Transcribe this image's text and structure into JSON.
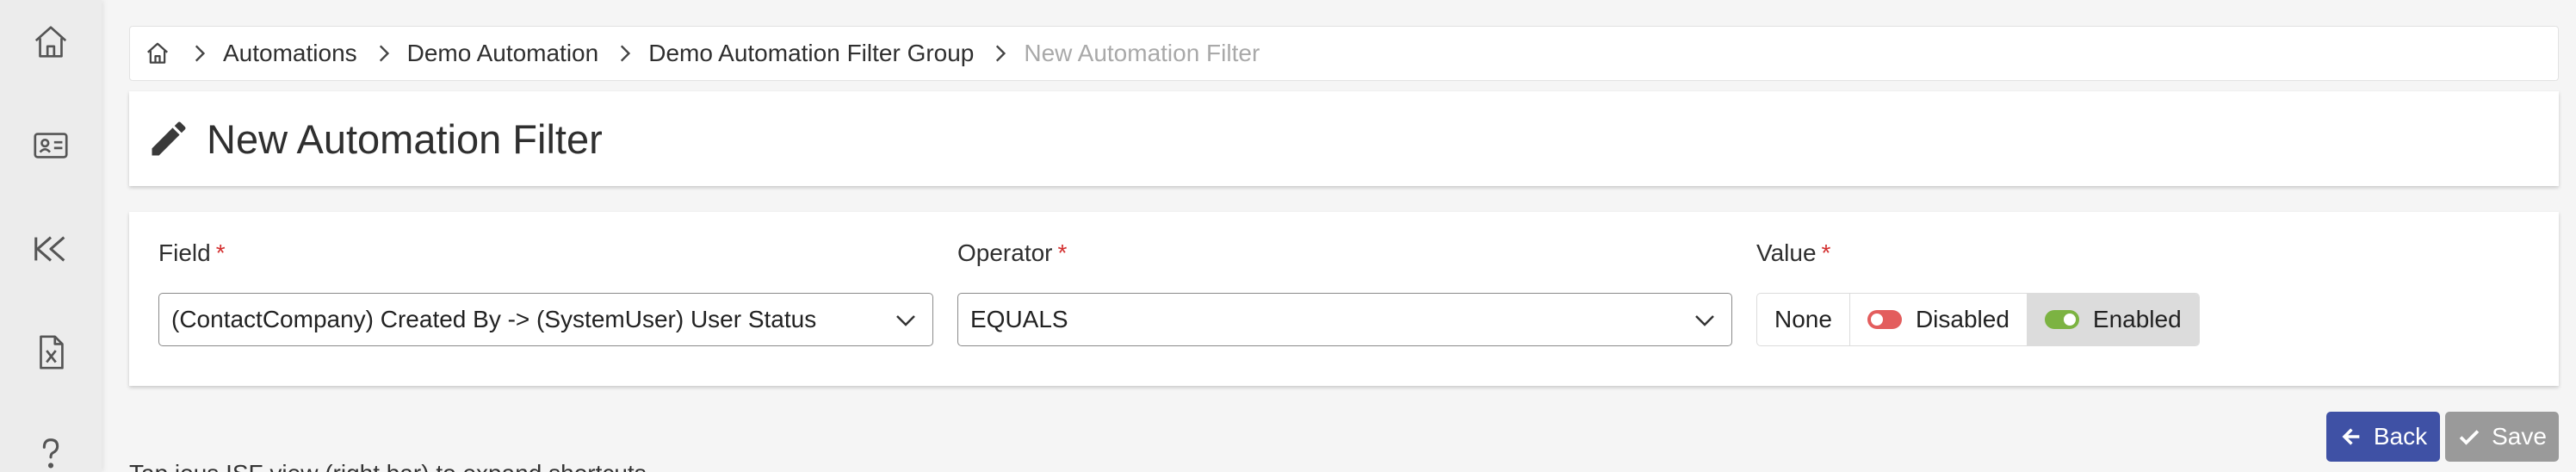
{
  "sidebar": {
    "items": [
      {
        "name": "home-icon"
      },
      {
        "name": "contact-card-icon"
      },
      {
        "name": "rewind-icon"
      },
      {
        "name": "excel-file-icon"
      },
      {
        "name": "help-icon"
      }
    ]
  },
  "breadcrumb": {
    "home_icon": "home-icon",
    "items": [
      "Automations",
      "Demo Automation",
      "Demo Automation Filter Group"
    ],
    "current": "New Automation Filter"
  },
  "page": {
    "title": "New Automation Filter",
    "title_icon": "pencil-icon"
  },
  "form": {
    "required_mark": "*",
    "field": {
      "label": "Field",
      "value": "(ContactCompany) Created By -> (SystemUser) User Status"
    },
    "operator": {
      "label": "Operator",
      "value": "EQUALS"
    },
    "value": {
      "label": "Value",
      "options": [
        "None",
        "Disabled",
        "Enabled"
      ],
      "selected": "Enabled"
    }
  },
  "actions": {
    "back_label": "Back",
    "save_label": "Save"
  },
  "hint": {
    "text": "Tap ious ISF view (right bar) to expand shortcuts"
  },
  "colors": {
    "accent": "#3f51a5",
    "required": "#d32f2f",
    "disabled_switch": "#e35d5d",
    "enabled_switch": "#7cb342",
    "save_disabled": "#9a9a9a"
  }
}
